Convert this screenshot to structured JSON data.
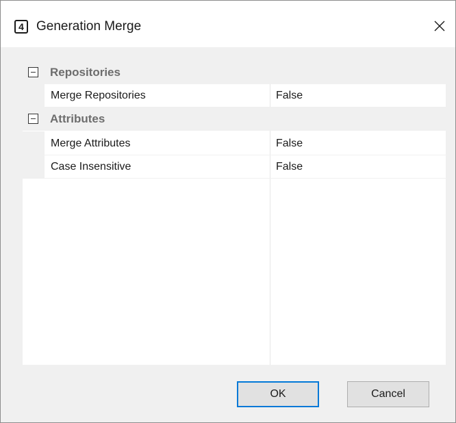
{
  "window": {
    "title": "Generation Merge",
    "icon_glyph": "4",
    "icon": "numbered-square-icon",
    "close_glyph": "✕"
  },
  "property_grid": {
    "categories": [
      {
        "label": "Repositories",
        "expanded": true,
        "properties": [
          {
            "name": "Merge Repositories",
            "value": "False"
          }
        ]
      },
      {
        "label": "Attributes",
        "expanded": true,
        "properties": [
          {
            "name": "Merge Attributes",
            "value": "False"
          },
          {
            "name": "Case Insensitive",
            "value": "False"
          }
        ]
      }
    ]
  },
  "buttons": {
    "ok_label": "OK",
    "cancel_label": "Cancel"
  },
  "colors": {
    "accent": "#0078d7",
    "category_text": "#6d6d6d",
    "dialog_bg": "#f0f0f0"
  }
}
